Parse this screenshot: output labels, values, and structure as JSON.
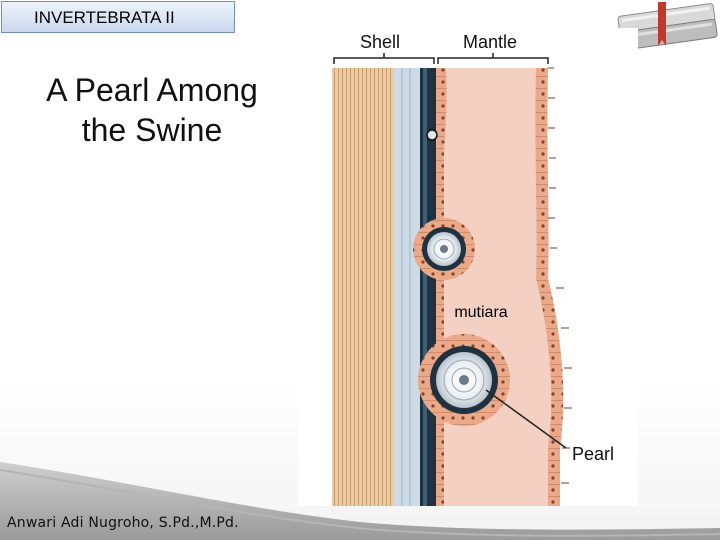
{
  "header": {
    "course_tab": "INVERTEBRATA II"
  },
  "slide": {
    "title_line1": "A Pearl Among",
    "title_line2": "the Swine",
    "author": "Anwari Adi Nugroho, S.Pd.,M.Pd."
  },
  "figure": {
    "label_shell": "Shell",
    "label_mantle": "Mantle",
    "label_pearl": "Pearl",
    "annotation": "mutiara"
  },
  "colors": {
    "tab_border": "#6f8fb8",
    "shell_tan": "#e6c79e",
    "nacre_blue": "#c9d9e4",
    "mantle_pink": "#f2cdbf",
    "epithelium": "#e8a888",
    "dark_layer": "#1c2e3c"
  }
}
